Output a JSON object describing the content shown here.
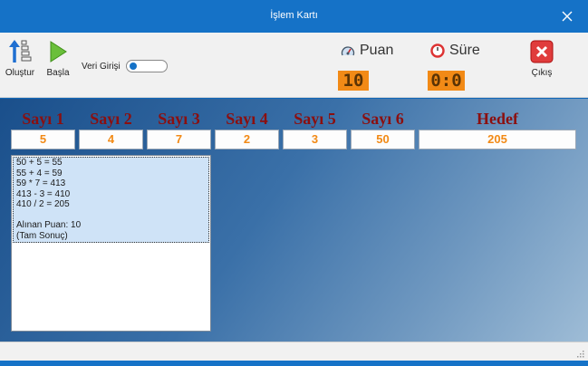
{
  "window": {
    "title": "İşlem Kartı"
  },
  "toolbar": {
    "create_label": "Oluştur",
    "start_label": "Başla",
    "input_toggle_label": "Veri Girişi",
    "exit_label": "Çıkış"
  },
  "stats": {
    "score_label": "Puan",
    "score_value": "10",
    "time_label": "Süre",
    "time_value": "0:0"
  },
  "numbers": {
    "headers": [
      "Sayı 1",
      "Sayı 2",
      "Sayı 3",
      "Sayı 4",
      "Sayı 5",
      "Sayı 6"
    ],
    "values": [
      "5",
      "4",
      "7",
      "2",
      "3",
      "50"
    ],
    "target_header": "Hedef",
    "target_value": "205"
  },
  "result": {
    "lines": [
      "50 + 5 = 55",
      "55 + 4 = 59",
      "59 * 7 = 413",
      "413 - 3 = 410",
      "410 / 2 = 205",
      "",
      "Alınan Puan: 10",
      "(Tam Sonuç)"
    ]
  },
  "colors": {
    "titlebar": "#1572c7",
    "accent_orange": "#f28a16",
    "header_red": "#8b0f0f",
    "exit_red": "#e03c3c"
  }
}
